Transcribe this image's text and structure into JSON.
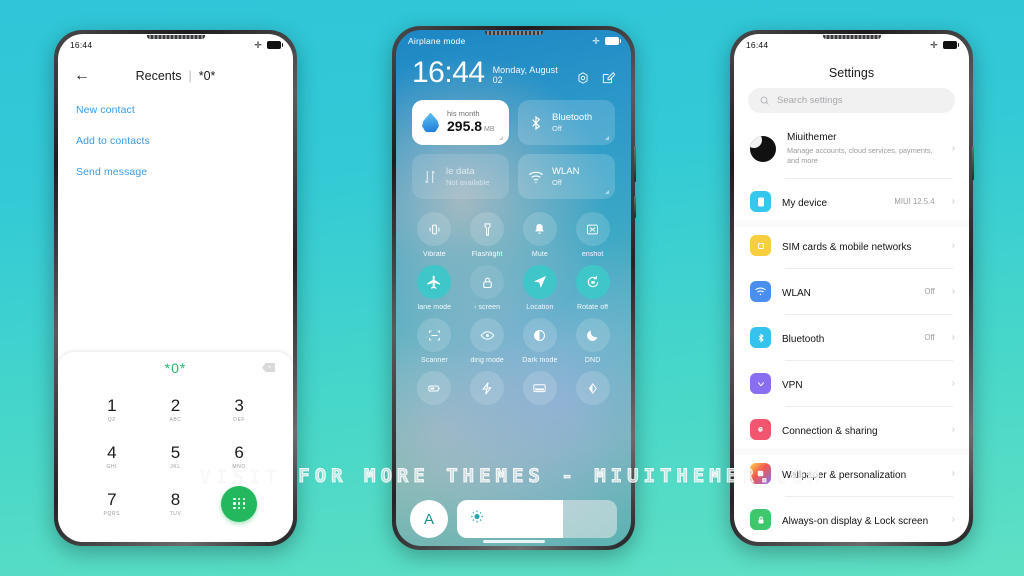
{
  "background": {
    "top_color": "#2ec6d8",
    "bottom_color": "#5fe0c4"
  },
  "watermark": {
    "text": "VISIT FOR MORE THEMES - MIUITHEMER.COM"
  },
  "phone1": {
    "status": {
      "time": "16:44",
      "airplane_icon": "airplane-icon",
      "battery_icon": "battery-icon"
    },
    "header": {
      "back_icon": "back-arrow-icon",
      "title": "Recents",
      "separator": "|",
      "number": "*0*"
    },
    "links": [
      {
        "label": "New contact"
      },
      {
        "label": "Add to contacts"
      },
      {
        "label": "Send message"
      }
    ],
    "dialpad": {
      "entry": "*0*",
      "backspace_icon": "backspace-icon",
      "keys": [
        {
          "digit": "1",
          "letters": "QZ"
        },
        {
          "digit": "2",
          "letters": "ABC"
        },
        {
          "digit": "3",
          "letters": "DEF"
        },
        {
          "digit": "4",
          "letters": "GHI"
        },
        {
          "digit": "5",
          "letters": "JKL"
        },
        {
          "digit": "6",
          "letters": "MNO"
        },
        {
          "digit": "7",
          "letters": "PQRS"
        },
        {
          "digit": "8",
          "letters": "TUV"
        }
      ],
      "call_button": {
        "icon": "dialpad-grid-icon",
        "color": "#23b85e"
      }
    }
  },
  "phone2": {
    "status": {
      "label": "Airplane mode",
      "airplane_icon": "airplane-icon",
      "battery_icon": "battery-icon"
    },
    "clock": {
      "time": "16:44",
      "date": "Monday, August 02"
    },
    "header_icons": [
      {
        "name": "settings-gear-icon"
      },
      {
        "name": "edit-pencil-icon"
      }
    ],
    "tiles": [
      {
        "name": "data-usage",
        "top": "his month",
        "value": "295.8",
        "unit": "MB",
        "icon": "water-drop-icon",
        "style": "white"
      },
      {
        "name": "bluetooth",
        "line1": "Bluetooth",
        "line2": "Off",
        "icon": "bluetooth-icon",
        "style": "normal"
      },
      {
        "name": "mobile-data",
        "line1": "le data",
        "line2": "Not available",
        "icon": "data-transfer-icon",
        "style": "dim"
      },
      {
        "name": "wlan",
        "line1": "WLAN",
        "line2": "Off",
        "icon": "wifi-icon",
        "style": "normal"
      }
    ],
    "toggles_row1": [
      {
        "label": "Vibrate",
        "icon": "vibrate-icon",
        "state": "off"
      },
      {
        "label": "Flashlight",
        "icon": "flashlight-icon",
        "state": "off"
      },
      {
        "label": "Mute",
        "icon": "bell-icon",
        "state": "off"
      },
      {
        "label": "enshot",
        "icon": "screenshot-icon",
        "state": "off"
      }
    ],
    "toggles_row2": [
      {
        "label": "lane mode",
        "icon": "airplane-icon",
        "state": "on"
      },
      {
        "label": "‹ screen",
        "icon": "lock-icon",
        "state": "off"
      },
      {
        "label": "Location",
        "icon": "location-arrow-icon",
        "state": "on"
      },
      {
        "label": "Rotate off",
        "icon": "rotate-lock-icon",
        "state": "on"
      }
    ],
    "toggles_row3": [
      {
        "label": "Scanner",
        "icon": "scanner-frame-icon",
        "state": "off"
      },
      {
        "label": "ding mode",
        "icon": "eye-icon",
        "state": "off"
      },
      {
        "label": "Dark mode",
        "icon": "contrast-icon",
        "state": "off"
      },
      {
        "label": "DND",
        "icon": "moon-icon",
        "state": "off"
      }
    ],
    "toggles_row4": [
      {
        "label": "",
        "icon": "battery-saver-icon",
        "state": "off"
      },
      {
        "label": "",
        "icon": "lightning-icon",
        "state": "off"
      },
      {
        "label": "",
        "icon": "cast-screen-icon",
        "state": "off"
      },
      {
        "label": "",
        "icon": "reading-contrast-icon",
        "state": "off"
      }
    ],
    "brightness": {
      "auto_label": "A",
      "sun_icon": "brightness-sun-icon",
      "level_percent": 66
    },
    "accent_color": "#3fc6c9"
  },
  "phone3": {
    "status": {
      "time": "16:44",
      "airplane_icon": "airplane-icon",
      "battery_icon": "battery-icon"
    },
    "title": "Settings",
    "search": {
      "placeholder": "Search settings",
      "icon": "search-icon"
    },
    "groups": [
      {
        "items": [
          {
            "name": "Miuithemer",
            "sub": "Manage accounts, cloud services, payments, and more",
            "value": "",
            "icon": "account-avatar-icon",
            "color": "#111111"
          },
          {
            "name": "My device",
            "sub": "",
            "value": "MIUI 12.5.4",
            "icon": "device-icon",
            "color": "#35c8ee"
          }
        ]
      },
      {
        "items": [
          {
            "name": "SIM cards & mobile networks",
            "sub": "",
            "value": "",
            "icon": "sim-card-icon",
            "color": "#f7cf3e"
          },
          {
            "name": "WLAN",
            "sub": "",
            "value": "Off",
            "icon": "wifi-icon",
            "color": "#4a8ef0"
          },
          {
            "name": "Bluetooth",
            "sub": "",
            "value": "Off",
            "icon": "bluetooth-icon",
            "color": "#35c2ee"
          },
          {
            "name": "VPN",
            "sub": "",
            "value": "",
            "icon": "vpn-icon",
            "color": "#8a6ef0"
          },
          {
            "name": "Connection & sharing",
            "sub": "",
            "value": "",
            "icon": "connection-sharing-icon",
            "color": "#f2566e"
          }
        ]
      },
      {
        "items": [
          {
            "name": "Wallpaper & personalization",
            "sub": "",
            "value": "",
            "icon": "wallpaper-icon",
            "color": "#f0584e"
          },
          {
            "name": "Always-on display & Lock screen",
            "sub": "",
            "value": "",
            "icon": "lock-screen-icon",
            "color": "#3ec86b"
          }
        ]
      }
    ],
    "chevron": "›"
  }
}
